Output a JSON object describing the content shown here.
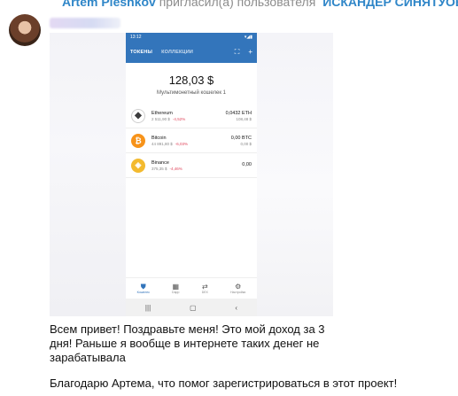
{
  "header": {
    "name": "Artem Pleshkov",
    "action": "пригласил(а) пользователя",
    "target": "ИСКАНДЕР СИНЯТУОВ"
  },
  "phone": {
    "status_time": "13:12",
    "status_right": "▾◢▮",
    "tabs": [
      "ТОКЕНЫ",
      "КОЛЛЕКЦИИ"
    ],
    "icons": [
      "scan-icon",
      "plus-icon"
    ],
    "balance": "128,03 $",
    "balance_subtitle": "Мультимонетный кошелек 1",
    "tokens": [
      {
        "name": "Ethereum",
        "price": "2 511,90 $",
        "change": "-4,52%",
        "amount": "0,0432 ETH",
        "value": "108,48 $",
        "icon": "ethereum-icon",
        "color": "#3c3c3d"
      },
      {
        "name": "Bitcoin",
        "price": "44 891,80 $",
        "change": "-6,03%",
        "amount": "0,00 BTC",
        "value": "0,00 $",
        "icon": "bitcoin-icon",
        "color": "#f7931a"
      },
      {
        "name": "Binance",
        "price": "375,35 $",
        "change": "-4,46%",
        "amount": "0,00",
        "value": "",
        "icon": "binance-icon",
        "color": "#f3ba2f"
      }
    ],
    "nav": [
      {
        "label": "Кошелек",
        "icon": "shield-icon"
      },
      {
        "label": "Dapp",
        "icon": "grid-icon"
      },
      {
        "label": "DEX",
        "icon": "swap-icon"
      },
      {
        "label": "Настройки",
        "icon": "gear-icon"
      }
    ]
  },
  "messages": {
    "text1": "Всем привет! Поздравьте меня! Это мой доход за 3 дня! Раньше я вообще в интернете таких денег не зарабатывала",
    "text2": "Благодарю Артема, что помог зарегистрироваться в этот проект!"
  },
  "colors": {
    "accent": "#3375bb",
    "link": "#2f86c8",
    "negative": "#e0465c"
  }
}
